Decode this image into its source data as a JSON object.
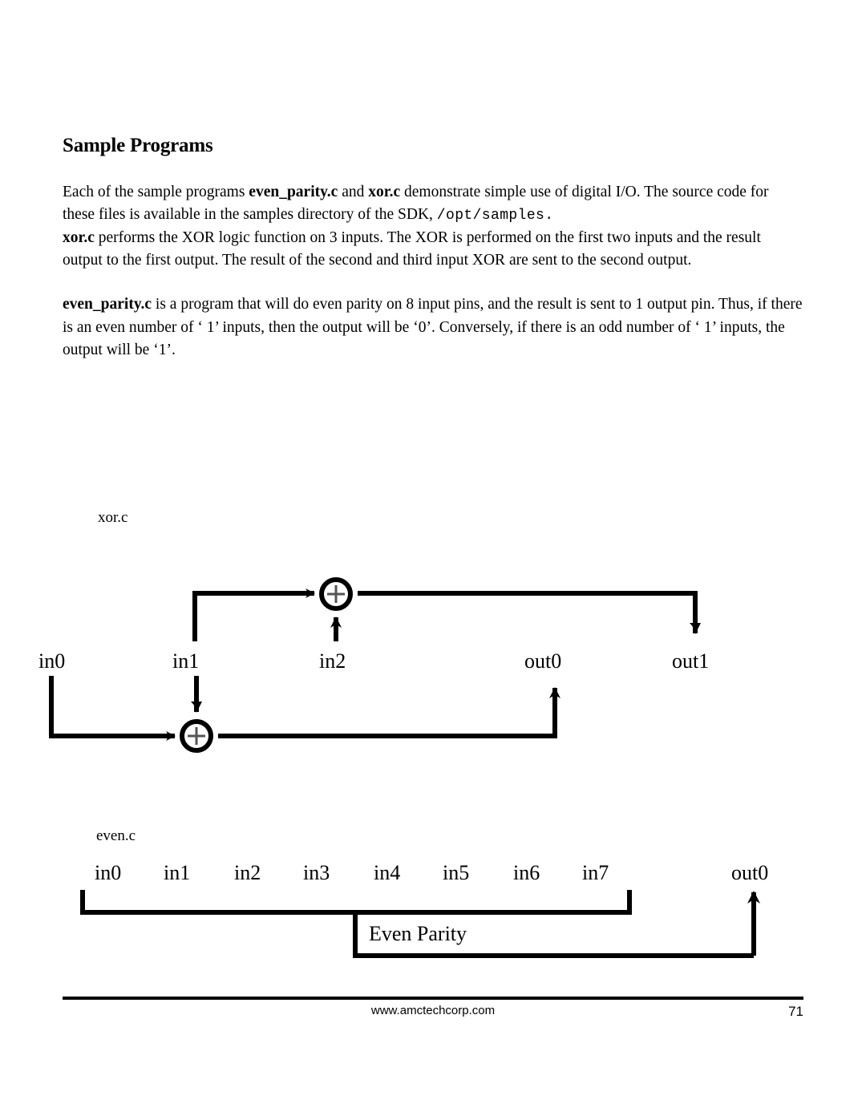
{
  "document": {
    "title": "Sample Programs",
    "paragraphs": [
      {
        "id": "p1",
        "runs": [
          {
            "text": "Each of the sample programs ",
            "style": "normal"
          },
          {
            "text": "even_parity.c",
            "style": "bold"
          },
          {
            "text": " and ",
            "style": "normal"
          },
          {
            "text": "xor.c",
            "style": "bold"
          },
          {
            "text": " demonstrate simple use of digital I/O.  The source code for these files is available in the samples directory of the SDK, ",
            "style": "normal"
          },
          {
            "text": "/opt/samples.",
            "style": "mono"
          }
        ]
      },
      {
        "id": "p2",
        "runs": [
          {
            "text": "xor.c",
            "style": "bold"
          },
          {
            "text": " performs the XOR logic function on 3 inputs.  The XOR is performed on the first two inputs and the result output to the first output.  The result of the second and third input XOR are sent to the second output.",
            "style": "normal"
          }
        ]
      },
      {
        "id": "p3",
        "runs": [
          {
            "text": "even_parity.c",
            "style": "bold"
          },
          {
            "text": " is a program that will do even parity on 8 input pins, and the result is sent to 1 output pin.  Thus, if there is an even number of ‘ 1’ inputs, then the output will be ‘0’.  Conversely, if there is an odd number of ‘ 1’ inputs, the output will be ‘1’.",
            "style": "normal"
          }
        ]
      }
    ]
  },
  "diagram_xor": {
    "caption": "xor.c",
    "labels": {
      "in0": "in0",
      "in1": "in1",
      "in2": "in2",
      "out0": "out0",
      "out1": "out1"
    },
    "gate_symbol": "+",
    "gate_count": 2,
    "description": "XOR of in0 and in1 goes to out0; XOR of in1 and in2 goes to out1"
  },
  "diagram_even": {
    "caption": "even.c",
    "block_label": "Even Parity",
    "inputs": [
      "in0",
      "in1",
      "in2",
      "in3",
      "in4",
      "in5",
      "in6",
      "in7"
    ],
    "outputs": [
      "out0"
    ]
  },
  "footer": {
    "url": "www.amctechcorp.com",
    "page_number": "71"
  },
  "colors": {
    "ink": "#000000",
    "paper": "#ffffff"
  }
}
